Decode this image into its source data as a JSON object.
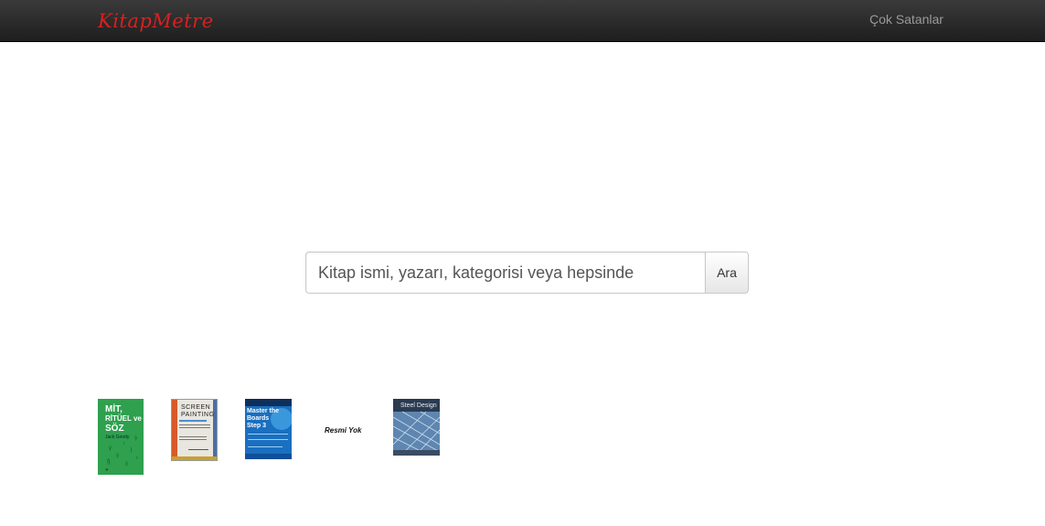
{
  "navbar": {
    "brand": "KitapMetre",
    "link": "Çok Satanlar"
  },
  "search": {
    "placeholder": "Kitap ismi, yazarı, kategorisi veya hepsinde",
    "button_label": "Ara"
  },
  "books": [
    {
      "cover_lines": [
        "MİT,",
        "RİTÜEL ve",
        "SÖZ",
        "Jack Goody"
      ],
      "color": "#2ea04e"
    },
    {
      "cover_lines": [
        "SCREEN",
        "PAINTING"
      ],
      "color": "#e8e6df"
    },
    {
      "cover_lines": [
        "Master the",
        "Boards",
        "Step 3"
      ],
      "color": "#1a6fc0"
    },
    {
      "cover_lines": [
        "Resmi Yok"
      ],
      "color": "#ffffff"
    },
    {
      "cover_lines": [
        "Steel Design"
      ],
      "color": "#3d4f66"
    }
  ],
  "colors": {
    "brand": "#d92020",
    "navbar": "#2a2a2a"
  }
}
